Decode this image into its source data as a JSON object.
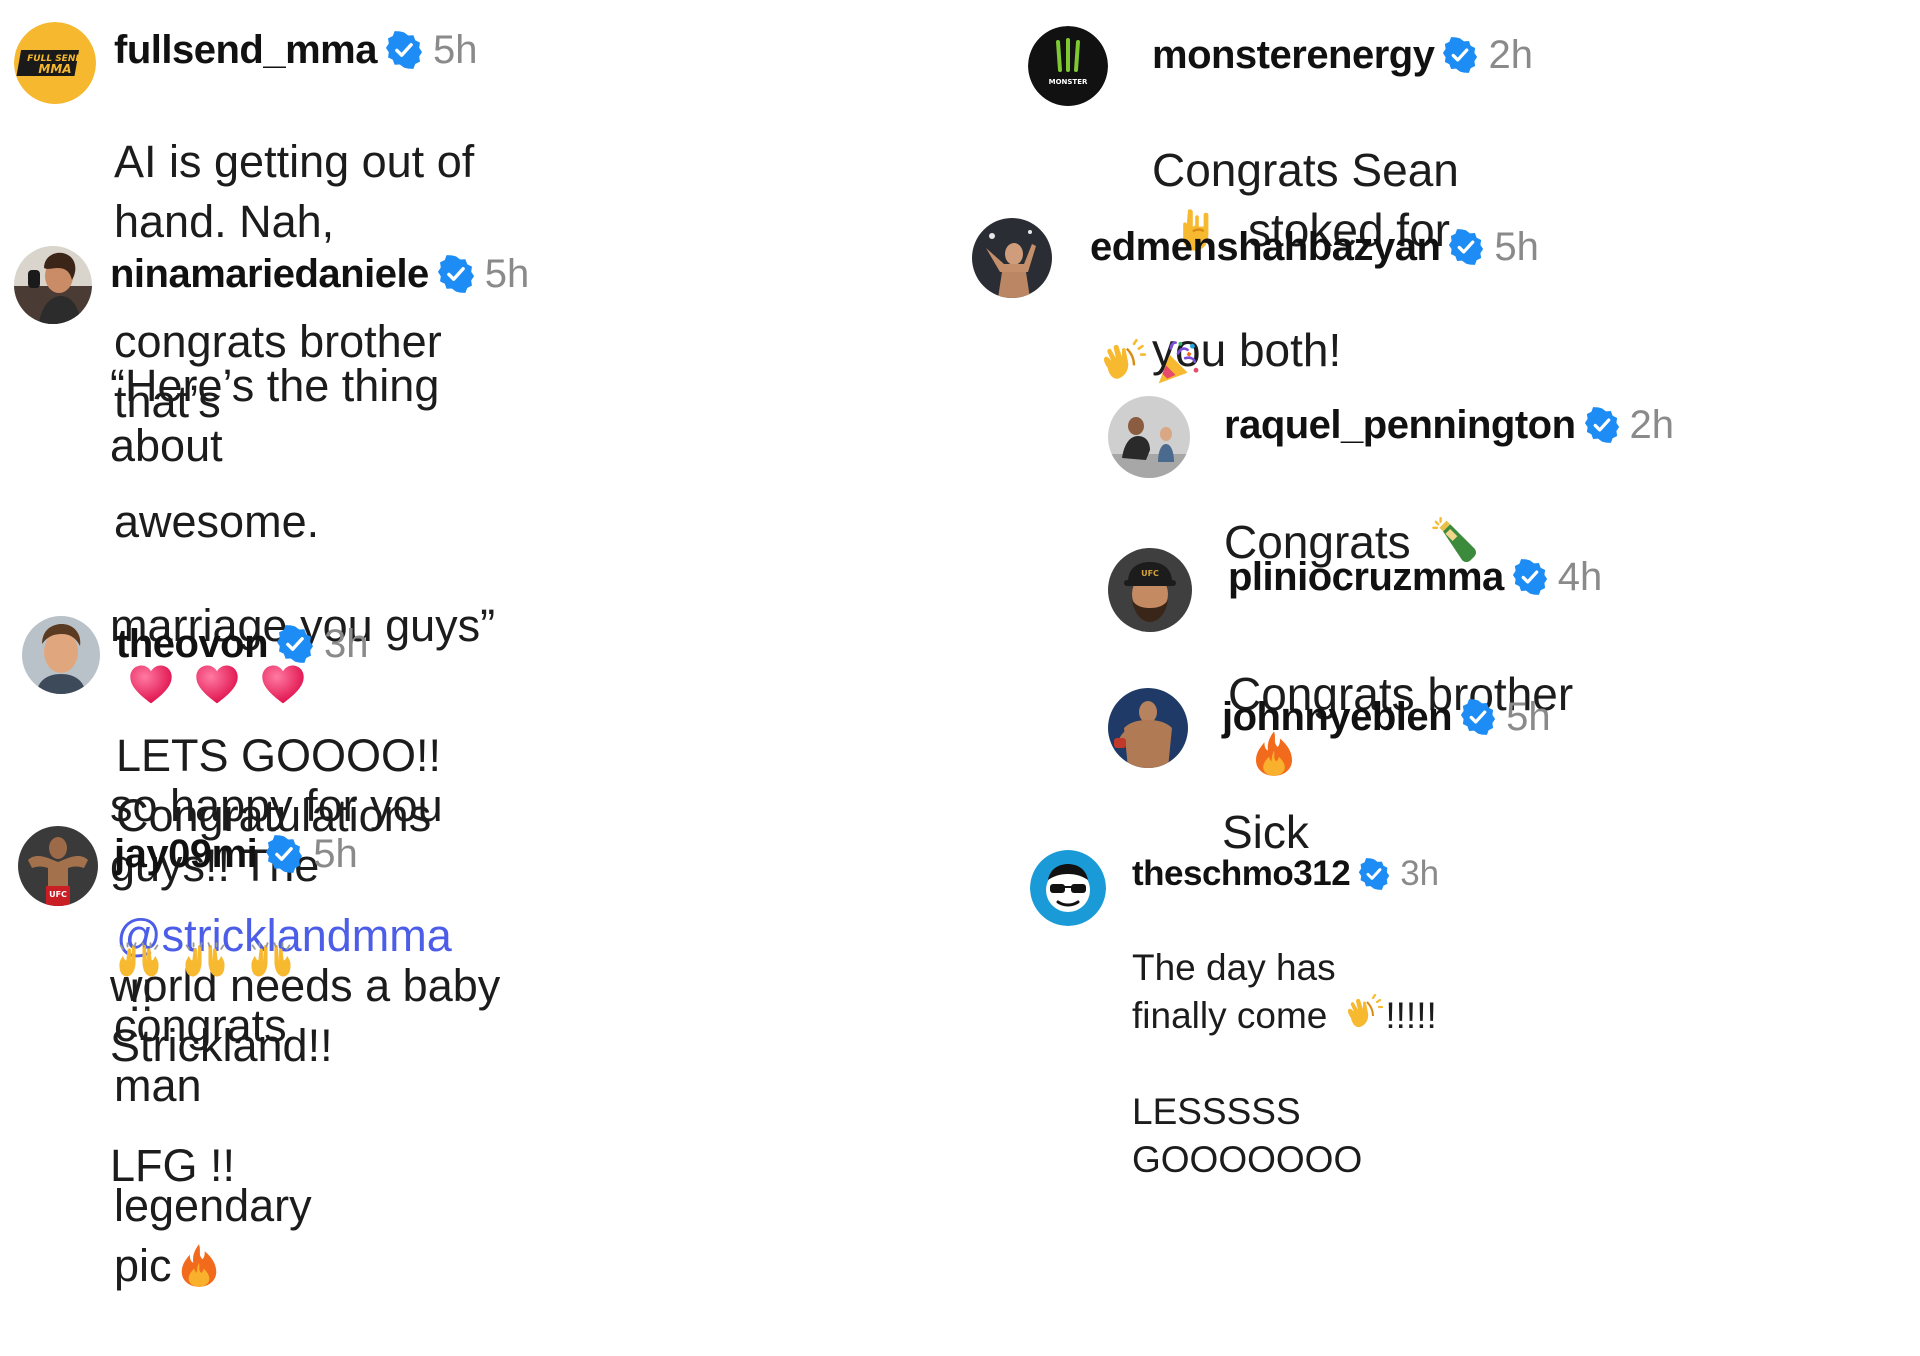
{
  "comments": [
    {
      "username": "fullsend_mma",
      "time": "5h",
      "lines": [
        "AI is getting out of hand. Nah,",
        "congrats brother that’s",
        "awesome."
      ],
      "avatar_icon": "fullsend-mma-logo",
      "avatar_text_1": "FULL SEND",
      "avatar_text_2": "MMA"
    },
    {
      "username": "ninamariedaniele",
      "time": "5h",
      "line1": "“Here’s the thing about",
      "line2": "marriage you guys”",
      "line2_emojis": [
        "heart",
        "heart",
        "heart"
      ],
      "line3": "so happy for you guys!! The",
      "line4": "world needs a baby Strickland!!",
      "line5": "LFG !!"
    },
    {
      "username": "theovon",
      "time": "3h",
      "line1": "LETS GOOOO!! Congratulations",
      "mention": "@stricklandmma",
      "after_mention": " !!"
    },
    {
      "username": "jay09mi",
      "time": "5h",
      "line1_emojis": [
        "raising-hands",
        "raising-hands",
        "raising-hands"
      ],
      "line1_text": "congrats man",
      "line2_text": "legendary pic",
      "line2_emoji": "fire"
    },
    {
      "username": "monsterenergy",
      "time": "2h",
      "line1_before": "Congrats Sean",
      "line1_emoji": "rock-on-hand",
      "line1_after": "stoked for",
      "line2": "you both!",
      "avatar_text": "MONSTER"
    },
    {
      "username": "edmenshahbazyan",
      "time": "5h",
      "emojis": [
        "clapping-hands",
        "party-popper"
      ]
    },
    {
      "username": "raquel_pennington",
      "time": "2h",
      "text": "Congrats",
      "emoji": "champagne-bottle"
    },
    {
      "username": "pliniocruzmma",
      "time": "4h",
      "text": "Congrats brother",
      "emoji": "fire",
      "avatar_cap_text": "UFC"
    },
    {
      "username": "johnnyeblen",
      "time": "5h",
      "text": "Sick"
    },
    {
      "username": "theschmo312",
      "time": "3h",
      "line1_before": "The day has finally come",
      "line1_emoji": "clapping-hands",
      "line1_after": "!!!!!",
      "line2": "LESSSSS GOOOOOOO"
    }
  ],
  "colors": {
    "verified": "#1d8cf4",
    "mention": "#4c5ee8",
    "time": "#8a8a8a",
    "fullsend_bg": "#f5b82e"
  },
  "jay09mi_avatar_badge": "UFC"
}
